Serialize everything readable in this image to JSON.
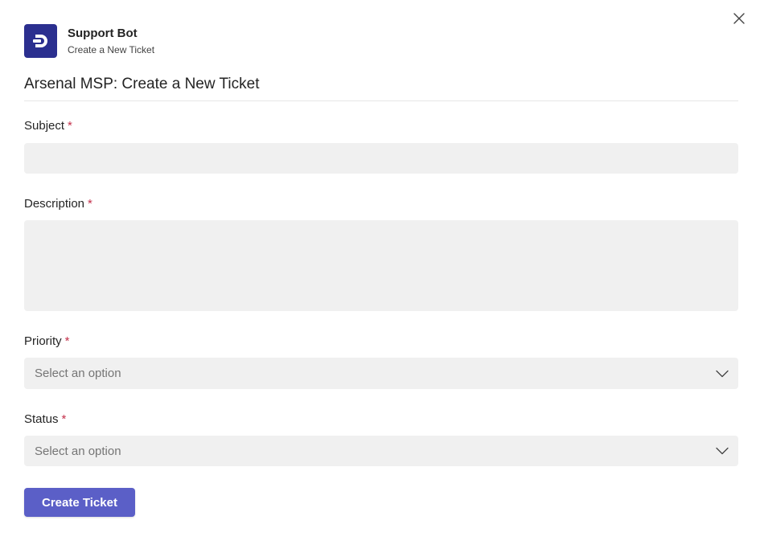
{
  "app": {
    "name": "Support Bot",
    "subtitle": "Create a New Ticket",
    "icon": "support-bot-logo-icon",
    "icon_color": "#2b2f8f"
  },
  "form": {
    "title": "Arsenal MSP: Create a New Ticket",
    "required_marker": "*",
    "fields": {
      "subject": {
        "label": "Subject",
        "value": ""
      },
      "description": {
        "label": "Description",
        "value": ""
      },
      "priority": {
        "label": "Priority",
        "placeholder": "Select an option"
      },
      "status": {
        "label": "Status",
        "placeholder": "Select an option"
      }
    },
    "submit_label": "Create Ticket"
  },
  "colors": {
    "accent": "#5b5fc7",
    "required": "#c4314b",
    "input_bg": "#f0f0f0"
  }
}
